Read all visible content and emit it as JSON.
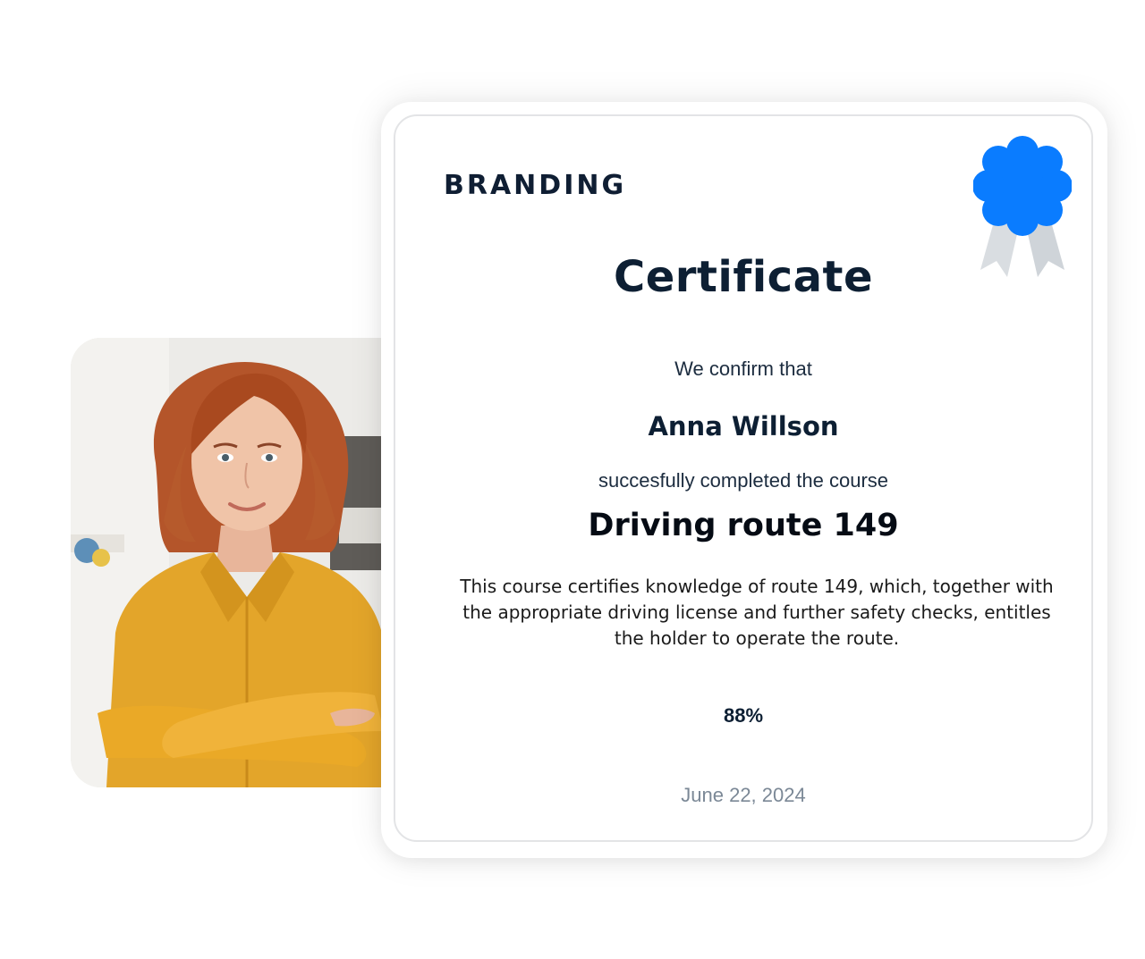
{
  "certificate": {
    "brand": "BRANDING",
    "title": "Certificate",
    "confirm_text": "We confirm that",
    "recipient_name": "Anna Willson",
    "completed_text": "succesfully completed the course",
    "course_name": "Driving route 149",
    "description": "This course certifies knowledge of route 149, which, together with the appropriate driving license and further safety checks, entitles the holder to operate the route.",
    "score": "88%",
    "date": "June 22, 2024"
  },
  "colors": {
    "rosette": "#0a7cff",
    "ribbon": "#d9dde1",
    "title": "#0d1f33",
    "date": "#7b8896"
  },
  "icons": {
    "award": "award-rosette-icon"
  }
}
